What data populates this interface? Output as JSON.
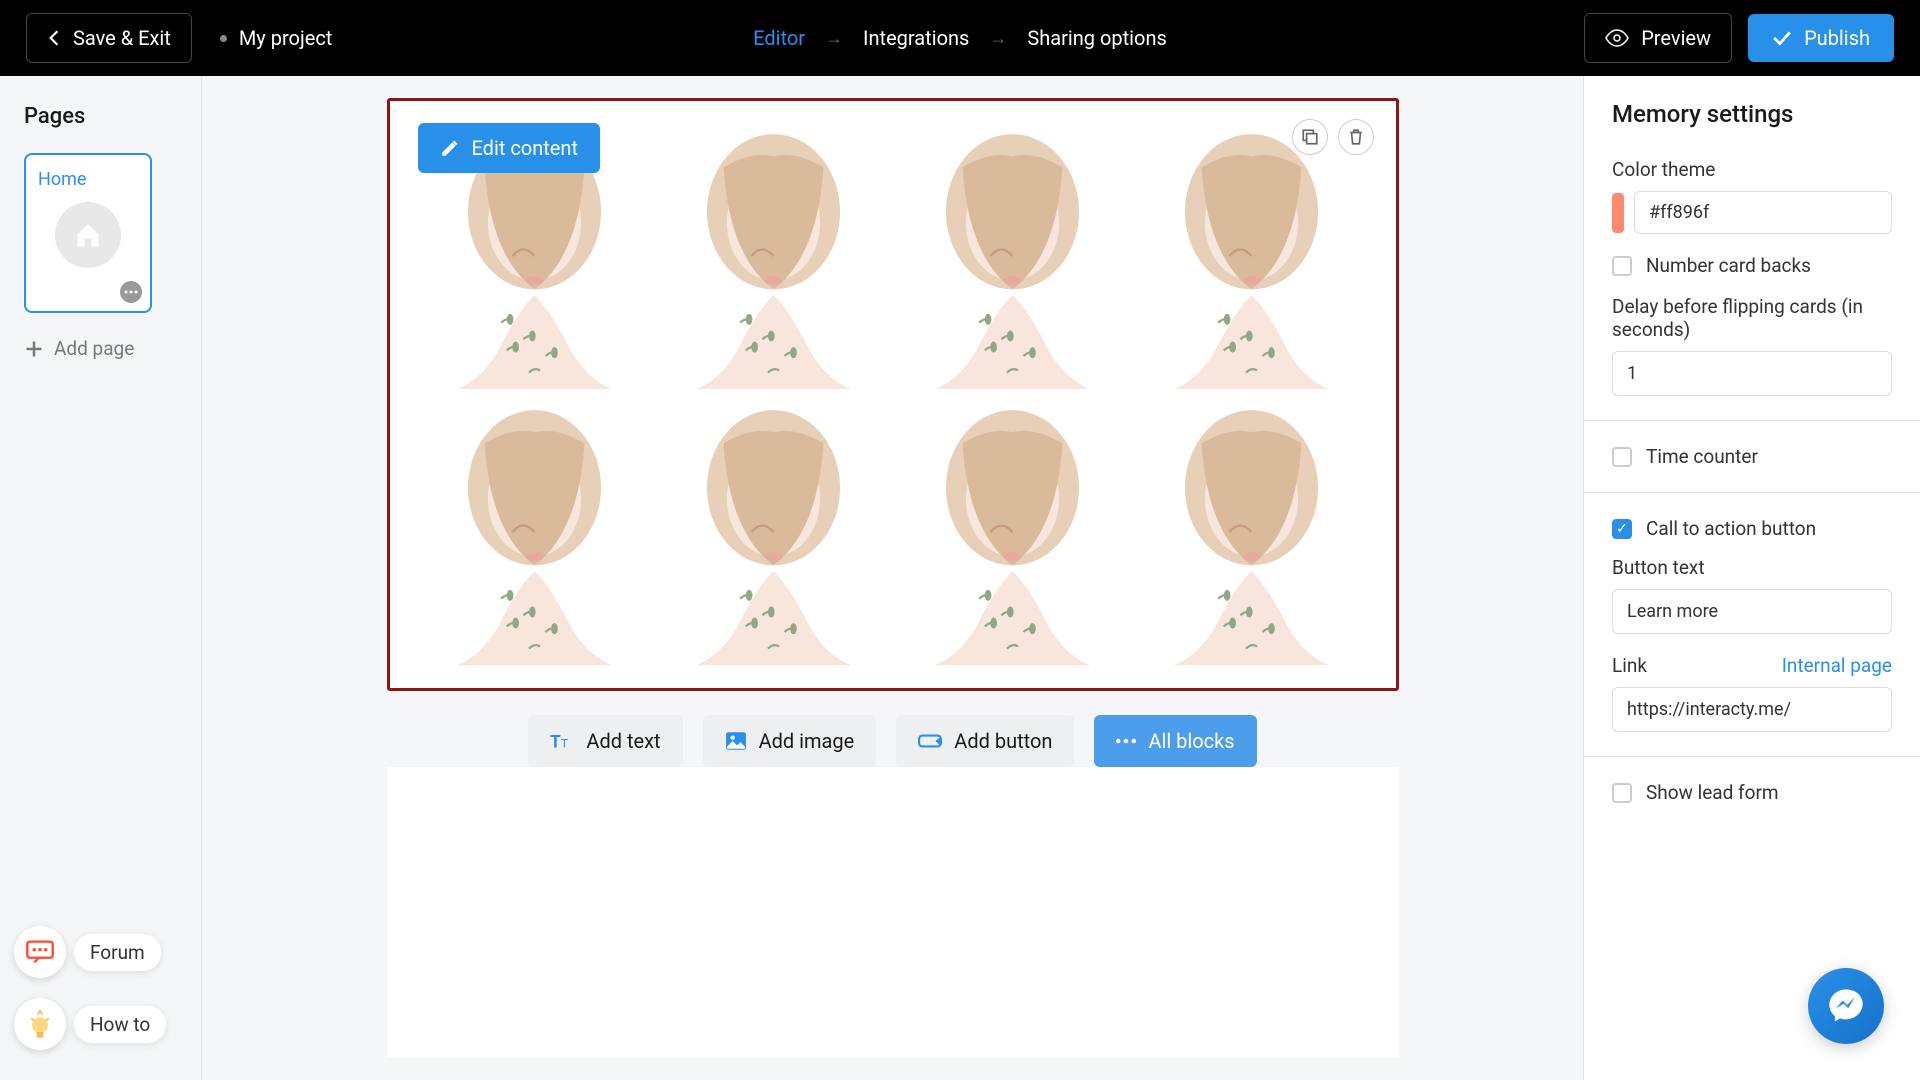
{
  "header": {
    "save_exit": "Save & Exit",
    "project_name": "My project",
    "nav": {
      "editor": "Editor",
      "integrations": "Integrations",
      "sharing": "Sharing options"
    },
    "preview": "Preview",
    "publish": "Publish"
  },
  "sidebar_left": {
    "pages_title": "Pages",
    "page_label": "Home",
    "add_page": "Add page",
    "forum": "Forum",
    "howto": "How to"
  },
  "canvas": {
    "edit_content": "Edit content",
    "toolbar": {
      "add_text": "Add text",
      "add_image": "Add image",
      "add_button": "Add button",
      "all_blocks": "All blocks"
    }
  },
  "settings": {
    "title": "Memory settings",
    "color_theme_label": "Color theme",
    "color_theme_value": "#ff896f",
    "number_card_backs": "Number card backs",
    "delay_label": "Delay before flipping cards (in seconds)",
    "delay_value": "1",
    "time_counter": "Time counter",
    "cta_label": "Call to action button",
    "button_text_label": "Button text",
    "button_text_value": "Learn more",
    "link_label": "Link",
    "internal_page": "Internal page",
    "link_value": "https://interacty.me/",
    "show_lead_form": "Show lead form"
  }
}
